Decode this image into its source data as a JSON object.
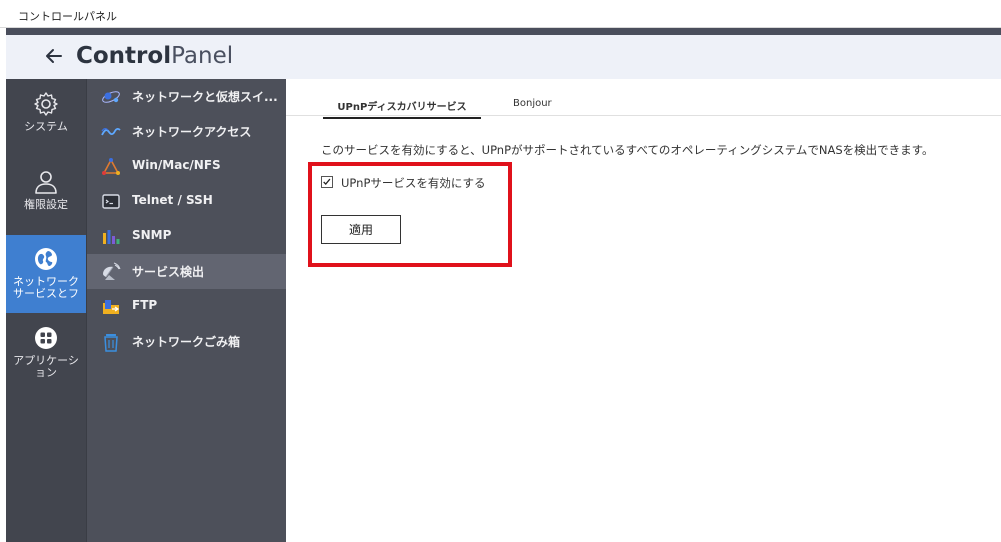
{
  "window": {
    "title": "コントロールパネル"
  },
  "header": {
    "title_bold": "Control",
    "title_light": "Panel"
  },
  "leftbar": {
    "items": [
      {
        "label": "システム",
        "icon": "gear-icon"
      },
      {
        "label": "権限設定",
        "icon": "user-icon"
      },
      {
        "label_line1": "ネットワーク",
        "label_line2": "サービスとフ",
        "icon": "globe-icon",
        "active": true
      },
      {
        "label_line1": "アプリケーシ",
        "label_line2": "ョン",
        "icon": "grid-icon"
      }
    ]
  },
  "subnav": {
    "items": [
      {
        "label": "ネットワークと仮想スイ...",
        "icon": "network-switch-icon"
      },
      {
        "label": "ネットワークアクセス",
        "icon": "network-access-icon"
      },
      {
        "label": "Win/Mac/NFS",
        "icon": "win-mac-nfs-icon"
      },
      {
        "label": "Telnet / SSH",
        "icon": "terminal-icon"
      },
      {
        "label": "SNMP",
        "icon": "snmp-chart-icon"
      },
      {
        "label": "サービス検出",
        "icon": "satellite-dish-icon",
        "active": true
      },
      {
        "label": "FTP",
        "icon": "ftp-folder-icon"
      },
      {
        "label": "ネットワークごみ箱",
        "icon": "trash-icon"
      }
    ]
  },
  "tabs": [
    {
      "label": "UPnPディスカバリサービス",
      "active": true
    },
    {
      "label": "Bonjour",
      "active": false
    }
  ],
  "main": {
    "description": "このサービスを有効にすると、UPnPがサポートされているすべてのオペレーティングシステムでNASを検出できます。",
    "checkbox_label": "UPnPサービスを有効にする",
    "checkbox_checked": true,
    "apply_label": "適用"
  },
  "colors": {
    "accent": "#3f7fd0",
    "highlight_border": "#e0111b",
    "sidebar_dark": "#42454e",
    "subnav_bg": "#4d505a"
  }
}
